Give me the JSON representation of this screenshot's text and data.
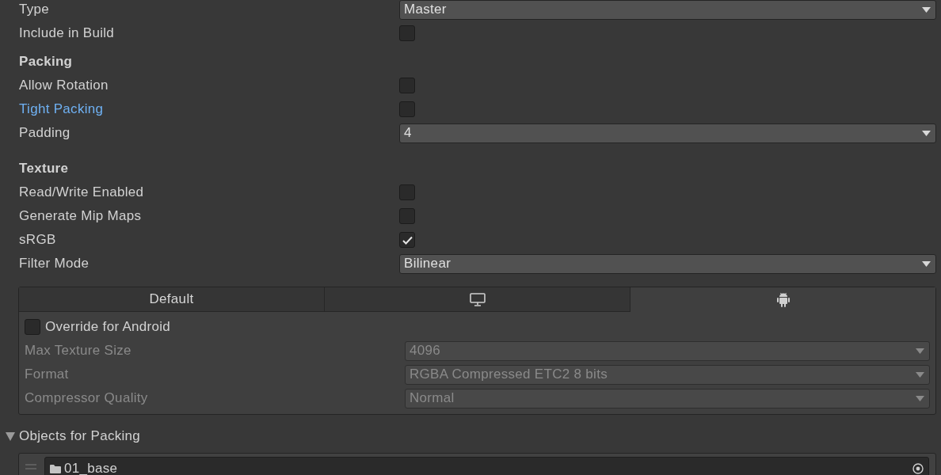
{
  "fields": [
    {
      "kind": "dropdown",
      "label": "Type",
      "value": "Master",
      "modified": false
    },
    {
      "kind": "checkbox",
      "label": "Include in Build",
      "checked": false,
      "modified": false
    },
    {
      "kind": "header",
      "label": "Packing"
    },
    {
      "kind": "checkbox",
      "label": "Allow Rotation",
      "checked": false,
      "modified": false
    },
    {
      "kind": "checkbox",
      "label": "Tight Packing",
      "checked": false,
      "modified": true
    },
    {
      "kind": "dropdown",
      "label": "Padding",
      "value": "4",
      "modified": false
    },
    {
      "kind": "header",
      "label": "Texture"
    },
    {
      "kind": "checkbox",
      "label": "Read/Write Enabled",
      "checked": false,
      "modified": false
    },
    {
      "kind": "checkbox",
      "label": "Generate Mip Maps",
      "checked": false,
      "modified": false
    },
    {
      "kind": "checkbox",
      "label": "sRGB",
      "checked": true,
      "modified": false
    },
    {
      "kind": "dropdown",
      "label": "Filter Mode",
      "value": "Bilinear",
      "modified": false
    }
  ],
  "platform_panel": {
    "tabs": [
      {
        "kind": "text",
        "label": "Default",
        "selected": false
      },
      {
        "kind": "monitor",
        "selected": false
      },
      {
        "kind": "android",
        "selected": true
      }
    ],
    "override": {
      "label": "Override for Android",
      "checked": false
    },
    "settings": [
      {
        "label": "Max Texture Size",
        "value": "4096",
        "disabled": true
      },
      {
        "label": "Format",
        "value": "RGBA Compressed ETC2 8 bits",
        "disabled": true
      },
      {
        "label": "Compressor Quality",
        "value": "Normal",
        "disabled": true
      }
    ]
  },
  "objects": {
    "label": "Objects for Packing",
    "expanded": true,
    "items": [
      {
        "name": "01_base"
      }
    ]
  }
}
